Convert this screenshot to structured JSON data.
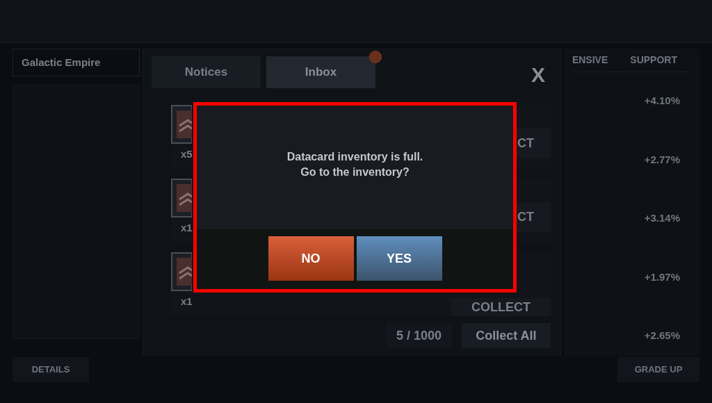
{
  "faction_panel": {
    "title": "Galactic Empire",
    "button": "DETAILS"
  },
  "mail_window": {
    "tabs": [
      {
        "label": "Notices",
        "selected": false,
        "badge": false
      },
      {
        "label": "Inbox",
        "selected": true,
        "badge": true
      }
    ],
    "close": "X",
    "rows": [
      {
        "quantity": "x5",
        "button": "CT"
      },
      {
        "quantity": "x1",
        "button": "CT"
      },
      {
        "quantity": "x1",
        "button": "COLLECT"
      }
    ],
    "counter": "5 / 1000",
    "collect_all": "Collect All"
  },
  "stats_panel": {
    "columns": [
      "ENSIVE",
      "SUPPORT"
    ],
    "values": [
      "+4.10%",
      "+2.77%",
      "+3.14%",
      "+1.97%",
      "+2.65%"
    ],
    "button": "GRADE UP"
  },
  "dialog": {
    "message": [
      "Datacard inventory is full.",
      "Go to the inventory?"
    ],
    "buttons": [
      {
        "label": "NO",
        "kind": "cancel"
      },
      {
        "label": "YES",
        "kind": "confirm"
      }
    ]
  }
}
